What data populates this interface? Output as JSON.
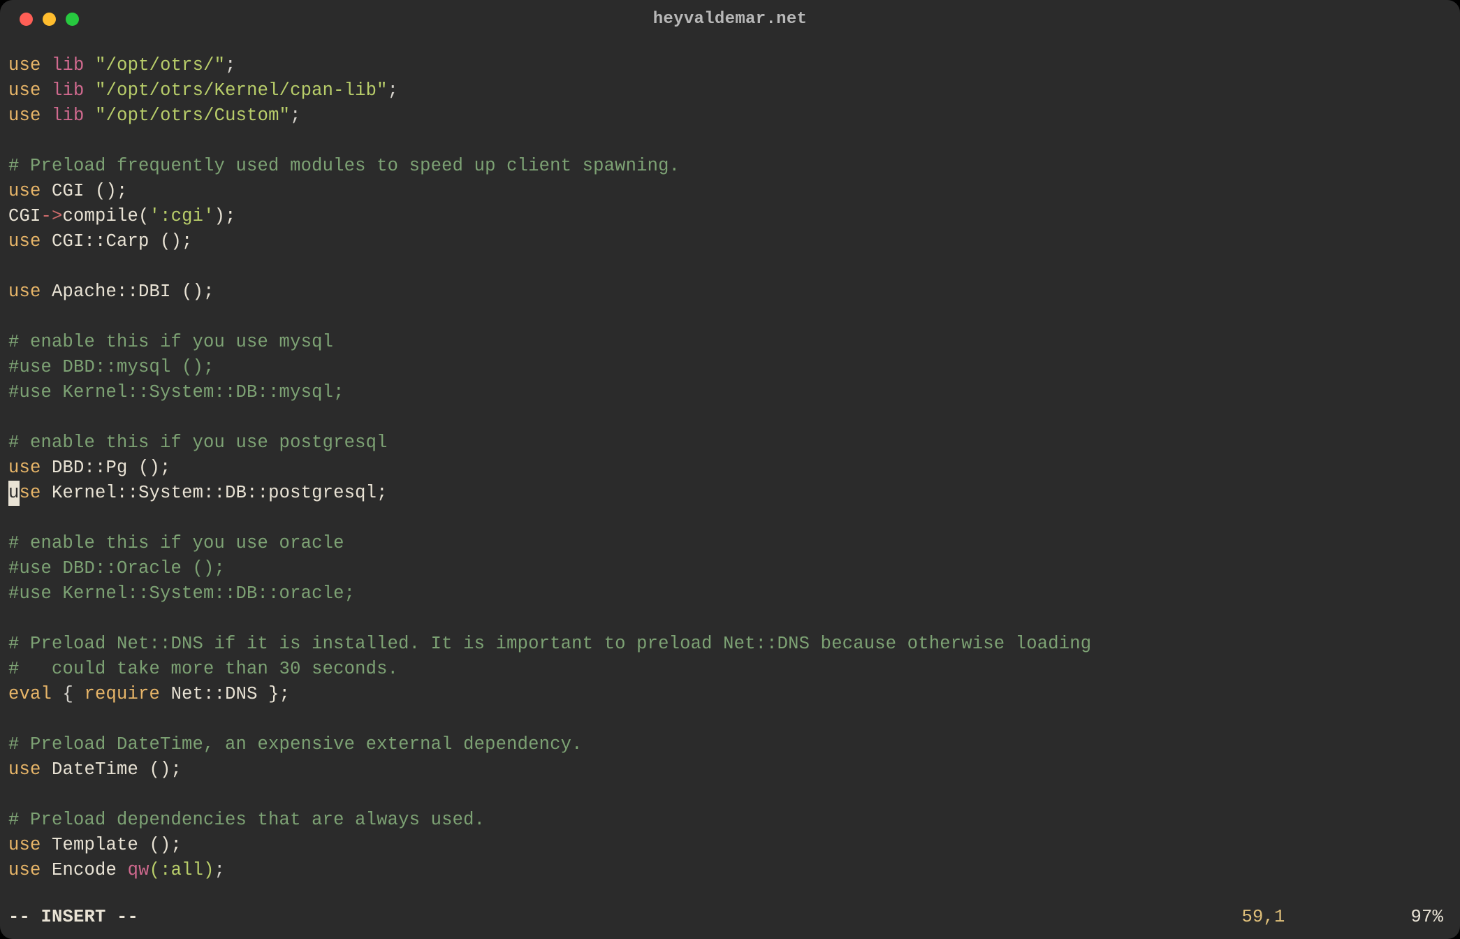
{
  "title": "heyvaldemar.net",
  "status": {
    "mode": "-- INSERT --",
    "position": "59,1",
    "percent": "97%"
  },
  "cursor": {
    "line": 17,
    "col": 0
  },
  "code_lines": [
    [
      {
        "t": "use",
        "c": "kw"
      },
      {
        "t": " "
      },
      {
        "t": "lib",
        "c": "pink"
      },
      {
        "t": " "
      },
      {
        "t": "\"/opt/otrs/\"",
        "c": "str"
      },
      {
        "t": ";"
      }
    ],
    [
      {
        "t": "use",
        "c": "kw"
      },
      {
        "t": " "
      },
      {
        "t": "lib",
        "c": "pink"
      },
      {
        "t": " "
      },
      {
        "t": "\"/opt/otrs/Kernel/cpan-lib\"",
        "c": "str"
      },
      {
        "t": ";"
      }
    ],
    [
      {
        "t": "use",
        "c": "kw"
      },
      {
        "t": " "
      },
      {
        "t": "lib",
        "c": "pink"
      },
      {
        "t": " "
      },
      {
        "t": "\"/opt/otrs/Custom\"",
        "c": "str"
      },
      {
        "t": ";"
      }
    ],
    [],
    [
      {
        "t": "# Preload frequently used modules to speed up client spawning.",
        "c": "comment"
      }
    ],
    [
      {
        "t": "use",
        "c": "kw"
      },
      {
        "t": " "
      },
      {
        "t": "CGI ();",
        "c": "ident"
      }
    ],
    [
      {
        "t": "CGI",
        "c": "ident"
      },
      {
        "t": "->",
        "c": "redish"
      },
      {
        "t": "compile(",
        "c": "ident"
      },
      {
        "t": "':cgi'",
        "c": "str"
      },
      {
        "t": ");",
        "c": "ident"
      }
    ],
    [
      {
        "t": "use",
        "c": "kw"
      },
      {
        "t": " "
      },
      {
        "t": "CGI::Carp ();",
        "c": "ident"
      }
    ],
    [],
    [
      {
        "t": "use",
        "c": "kw"
      },
      {
        "t": " "
      },
      {
        "t": "Apache::DBI ();",
        "c": "ident"
      }
    ],
    [],
    [
      {
        "t": "# enable this if you use mysql",
        "c": "comment"
      }
    ],
    [
      {
        "t": "#use DBD::mysql ();",
        "c": "comment"
      }
    ],
    [
      {
        "t": "#use Kernel::System::DB::mysql;",
        "c": "comment"
      }
    ],
    [],
    [
      {
        "t": "# enable this if you use postgresql",
        "c": "comment"
      }
    ],
    [
      {
        "t": "use",
        "c": "kw"
      },
      {
        "t": " "
      },
      {
        "t": "DBD::Pg ();",
        "c": "ident"
      }
    ],
    [
      {
        "t": "use",
        "c": "kw"
      },
      {
        "t": " "
      },
      {
        "t": "Kernel::System::DB::postgresql;",
        "c": "ident"
      }
    ],
    [],
    [
      {
        "t": "# enable this if you use oracle",
        "c": "comment"
      }
    ],
    [
      {
        "t": "#use DBD::Oracle ();",
        "c": "comment"
      }
    ],
    [
      {
        "t": "#use Kernel::System::DB::oracle;",
        "c": "comment"
      }
    ],
    [],
    [
      {
        "t": "# Preload Net::DNS if it is installed. It is important to preload Net::DNS because otherwise loading",
        "c": "comment"
      }
    ],
    [
      {
        "t": "#   could take more than 30 seconds.",
        "c": "comment"
      }
    ],
    [
      {
        "t": "eval",
        "c": "kw"
      },
      {
        "t": " { "
      },
      {
        "t": "require",
        "c": "kw"
      },
      {
        "t": " "
      },
      {
        "t": "Net::DNS };",
        "c": "ident"
      }
    ],
    [],
    [
      {
        "t": "# Preload DateTime, an expensive external dependency.",
        "c": "comment"
      }
    ],
    [
      {
        "t": "use",
        "c": "kw"
      },
      {
        "t": " "
      },
      {
        "t": "DateTime ();",
        "c": "ident"
      }
    ],
    [],
    [
      {
        "t": "# Preload dependencies that are always used.",
        "c": "comment"
      }
    ],
    [
      {
        "t": "use",
        "c": "kw"
      },
      {
        "t": " "
      },
      {
        "t": "Template ();",
        "c": "ident"
      }
    ],
    [
      {
        "t": "use",
        "c": "kw"
      },
      {
        "t": " "
      },
      {
        "t": "Encode ",
        "c": "ident"
      },
      {
        "t": "qw",
        "c": "pink"
      },
      {
        "t": "(:all)",
        "c": "str"
      },
      {
        "t": ";"
      }
    ]
  ]
}
